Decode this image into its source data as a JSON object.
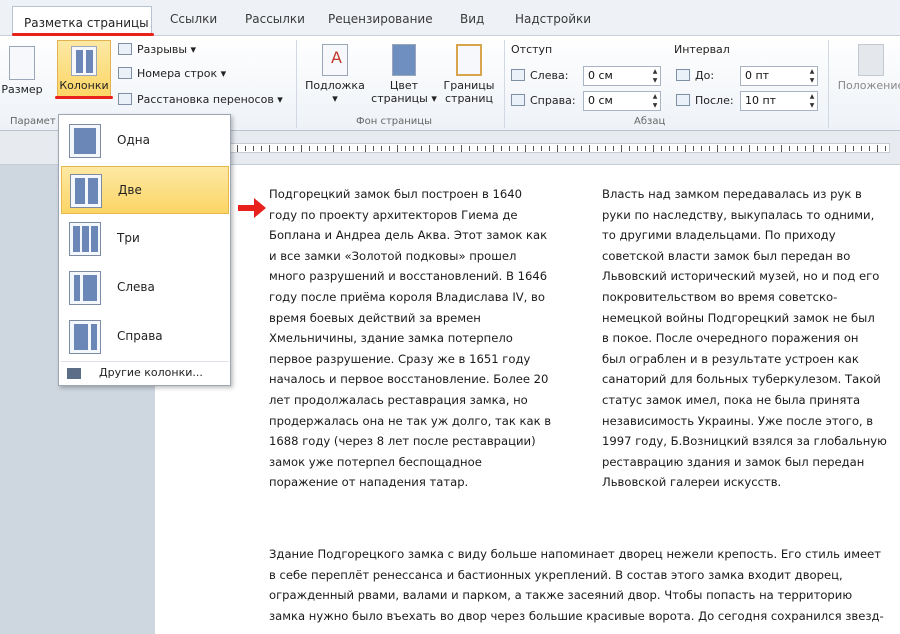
{
  "tabs": [
    "Разметка страницы",
    "Ссылки",
    "Рассылки",
    "Рецензирование",
    "Вид",
    "Надстройки"
  ],
  "ribbon": {
    "page_setup": {
      "size_label": "Размер",
      "columns_label": "Колонки",
      "breaks_label": "Разрывы ▾",
      "line_numbers_label": "Номера строк ▾",
      "hyphenation_label": "Расстановка переносов ▾",
      "group_label": "Парамет"
    },
    "background": {
      "watermark_label": [
        "Подложка",
        "▾"
      ],
      "page_color_label": [
        "Цвет",
        "страницы ▾"
      ],
      "page_borders_label": [
        "Границы",
        "страниц"
      ],
      "group_label": "Фон страницы"
    },
    "paragraph": {
      "indent_title": "Отступ",
      "left_label": "Слева:",
      "left_value": "0 см",
      "right_label": "Справа:",
      "right_value": "0 см",
      "spacing_title": "Интервал",
      "before_label": "До:",
      "before_value": "0 пт",
      "after_label": "После:",
      "after_value": "10 пт",
      "group_label": "Абзац"
    },
    "arrange_label": "Положение"
  },
  "dropdown": {
    "items": [
      "Одна",
      "Две",
      "Три",
      "Слева",
      "Справа"
    ],
    "selected": "Две",
    "more_label": "Другие колонки..."
  },
  "document": {
    "col1": [
      "Подгорецкий замок был построен в 1640",
      "году по проекту архитекторов Гиема де",
      "Боплана и Андреа дель Аква. Этот замок как",
      "и все замки «Золотой подковы» прошел",
      "много разрушений и восстановлений. В 1646",
      "году после приёма короля Владислава IV, во",
      "время боевых действий за времен",
      "Хмельничины, здание замка потерпело",
      "первое разрушение. Сразу же в 1651 году",
      "началось и первое восстановление. Более 20",
      "лет продолжалась реставрация замка, но",
      "продержалась она не так уж долго, так как в",
      "1688 году (через 8 лет после реставрации)",
      "замок уже потерпел беспощадное",
      "поражение от нападения татар."
    ],
    "col2": [
      "Власть над замком передавалась из рук в",
      "руки по наследству, выкупалась то одними,",
      "то другими владельцами. По приходу",
      "советской власти замок был передан во",
      "Львовский исторический музей, но и под его",
      "покровительством во время советско-",
      "немецкой войны Подгорецкий замок не был",
      "в покое. После очередного поражения он",
      "был ограблен и в результате устроен как",
      "санаторий для больных туберкулезом. Такой",
      "статус замок имел, пока не была принята",
      "независимость Украины. Уже после этого, в",
      "1997 году, Б.Возницкий взялся за глобальную",
      "реставрацию здания и замок был передан",
      "Львовской галереи искусств."
    ],
    "full": [
      "Здание Подгорецкого замка с виду больше напоминает дворец нежели крепость. Его стиль имеет",
      "в себе переплёт ренессанса и бастионных укреплений. В состав этого замка входит дворец,",
      "огражденный рвами, валами и парком, а также засеяний двор. Чтобы попасть на территорию",
      "замка нужно было въехать во двор через большие красивые ворота. До сегодня сохранился звезд-"
    ]
  },
  "colors": {
    "highlight_red": "#e8211b",
    "selected_item": "#fcd565"
  }
}
